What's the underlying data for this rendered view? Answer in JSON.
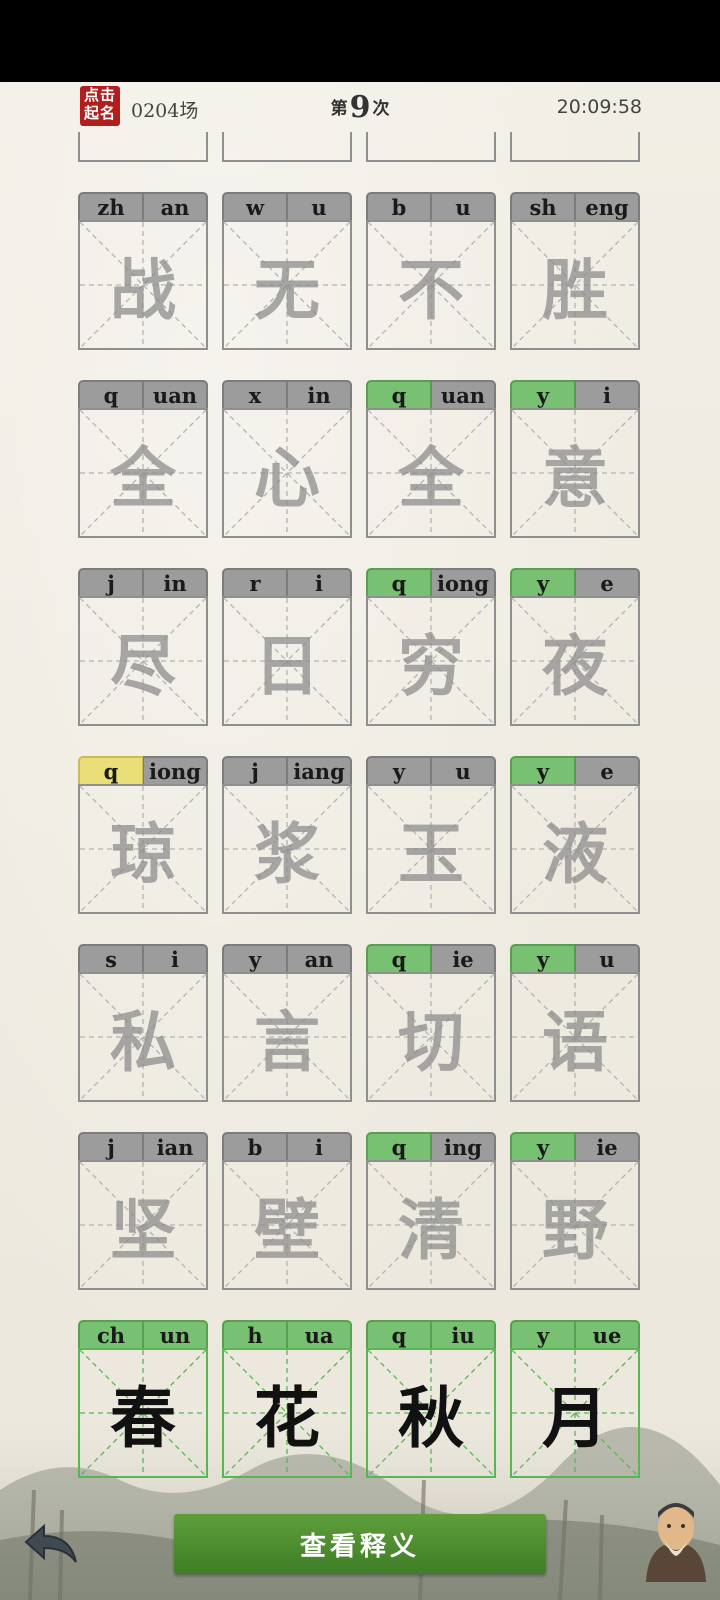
{
  "header": {
    "seal_line1": "点击",
    "seal_line2": "起名",
    "round_label": "0204场",
    "attempt_prefix": "第",
    "attempt_number": "9",
    "attempt_suffix": "次",
    "clock": "20:09:58"
  },
  "rows": [
    {
      "cells": [
        {
          "initial": "zh",
          "final": "an",
          "char": "战",
          "initial_state": "grey",
          "final_state": "grey"
        },
        {
          "initial": "w",
          "final": "u",
          "char": "无",
          "initial_state": "grey",
          "final_state": "grey"
        },
        {
          "initial": "b",
          "final": "u",
          "char": "不",
          "initial_state": "grey",
          "final_state": "grey"
        },
        {
          "initial": "sh",
          "final": "eng",
          "char": "胜",
          "initial_state": "grey",
          "final_state": "grey"
        }
      ]
    },
    {
      "cells": [
        {
          "initial": "q",
          "final": "uan",
          "char": "全",
          "initial_state": "grey",
          "final_state": "grey"
        },
        {
          "initial": "x",
          "final": "in",
          "char": "心",
          "initial_state": "grey",
          "final_state": "grey"
        },
        {
          "initial": "q",
          "final": "uan",
          "char": "全",
          "initial_state": "green",
          "final_state": "grey"
        },
        {
          "initial": "y",
          "final": "i",
          "char": "意",
          "initial_state": "green",
          "final_state": "grey"
        }
      ]
    },
    {
      "cells": [
        {
          "initial": "j",
          "final": "in",
          "char": "尽",
          "initial_state": "grey",
          "final_state": "grey"
        },
        {
          "initial": "r",
          "final": "i",
          "char": "日",
          "initial_state": "grey",
          "final_state": "grey"
        },
        {
          "initial": "q",
          "final": "iong",
          "char": "穷",
          "initial_state": "green",
          "final_state": "grey"
        },
        {
          "initial": "y",
          "final": "e",
          "char": "夜",
          "initial_state": "green",
          "final_state": "grey"
        }
      ]
    },
    {
      "cells": [
        {
          "initial": "q",
          "final": "iong",
          "char": "琼",
          "initial_state": "yellow",
          "final_state": "grey"
        },
        {
          "initial": "j",
          "final": "iang",
          "char": "浆",
          "initial_state": "grey",
          "final_state": "grey"
        },
        {
          "initial": "y",
          "final": "u",
          "char": "玉",
          "initial_state": "grey",
          "final_state": "grey"
        },
        {
          "initial": "y",
          "final": "e",
          "char": "液",
          "initial_state": "green",
          "final_state": "grey"
        }
      ]
    },
    {
      "cells": [
        {
          "initial": "s",
          "final": "i",
          "char": "私",
          "initial_state": "grey",
          "final_state": "grey"
        },
        {
          "initial": "y",
          "final": "an",
          "char": "言",
          "initial_state": "grey",
          "final_state": "grey"
        },
        {
          "initial": "q",
          "final": "ie",
          "char": "切",
          "initial_state": "green",
          "final_state": "grey"
        },
        {
          "initial": "y",
          "final": "u",
          "char": "语",
          "initial_state": "green",
          "final_state": "grey"
        }
      ]
    },
    {
      "cells": [
        {
          "initial": "j",
          "final": "ian",
          "char": "坚",
          "initial_state": "grey",
          "final_state": "grey"
        },
        {
          "initial": "b",
          "final": "i",
          "char": "壁",
          "initial_state": "grey",
          "final_state": "grey"
        },
        {
          "initial": "q",
          "final": "ing",
          "char": "清",
          "initial_state": "green",
          "final_state": "grey"
        },
        {
          "initial": "y",
          "final": "ie",
          "char": "野",
          "initial_state": "green",
          "final_state": "grey"
        }
      ]
    },
    {
      "cells": [
        {
          "initial": "ch",
          "final": "un",
          "char": "春",
          "initial_state": "green",
          "final_state": "green"
        },
        {
          "initial": "h",
          "final": "ua",
          "char": "花",
          "initial_state": "green",
          "final_state": "green"
        },
        {
          "initial": "q",
          "final": "iu",
          "char": "秋",
          "initial_state": "green",
          "final_state": "green"
        },
        {
          "initial": "y",
          "final": "ue",
          "char": "月",
          "initial_state": "green",
          "final_state": "green"
        }
      ],
      "solved": true
    }
  ],
  "bottom": {
    "meaning_button": "查看释义"
  },
  "colors": {
    "green": "#78c173",
    "yellow": "#e9de78",
    "grey": "#9c9c9c",
    "seal": "#b01e1e",
    "button": "#4a8a2e"
  },
  "icons": {
    "back": "back-arrow-icon",
    "avatar": "confucius-avatar-icon"
  }
}
